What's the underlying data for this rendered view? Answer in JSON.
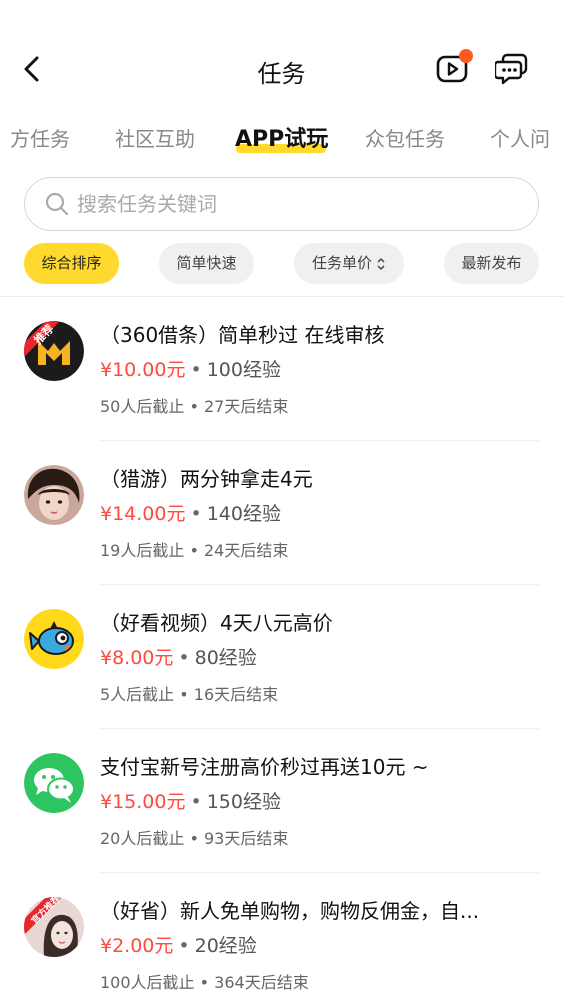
{
  "header": {
    "title": "任务",
    "back_icon": "chevron-left-icon",
    "video_icon": "video-play-icon",
    "message_icon": "chat-icon",
    "notification_color": "#ff5a1f"
  },
  "tabs": [
    {
      "label": "方任务",
      "active": false
    },
    {
      "label": "社区互助",
      "active": false
    },
    {
      "label": "APP试玩",
      "active": true
    },
    {
      "label": "众包任务",
      "active": false
    },
    {
      "label": "个人问",
      "active": false
    }
  ],
  "search": {
    "placeholder": "搜索任务关键词",
    "value": ""
  },
  "filters": [
    {
      "label": "综合排序",
      "active": true
    },
    {
      "label": "简单快速",
      "active": false
    },
    {
      "label": "任务单价",
      "active": false,
      "icon": "sort-updown-icon"
    },
    {
      "label": "最新发布",
      "active": false
    }
  ],
  "colors": {
    "accent": "#ffd92e",
    "price": "#ff4a3d"
  },
  "tasks": [
    {
      "title": "（360借条）简单秒过 在线审核",
      "price": "¥10.00元",
      "exp": "100经验",
      "meta": "50人后截止 • 27天后结束",
      "badge": "推荐"
    },
    {
      "title": "（猎游）两分钟拿走4元",
      "price": "¥14.00元",
      "exp": "140经验",
      "meta": "19人后截止 • 24天后结束"
    },
    {
      "title": "（好看视频）4天八元高价",
      "price": "¥8.00元",
      "exp": "80经验",
      "meta": "5人后截止 • 16天后结束"
    },
    {
      "title": "支付宝新号注册高价秒过再送10元 ~",
      "price": "¥15.00元",
      "exp": "150经验",
      "meta": "20人后截止 • 93天后结束"
    },
    {
      "title": "（好省）新人免单购物，购物反佣金，自...",
      "price": "¥2.00元",
      "exp": "20经验",
      "meta": "100人后截止 • 364天后结束",
      "badge": "官方推荐"
    }
  ]
}
